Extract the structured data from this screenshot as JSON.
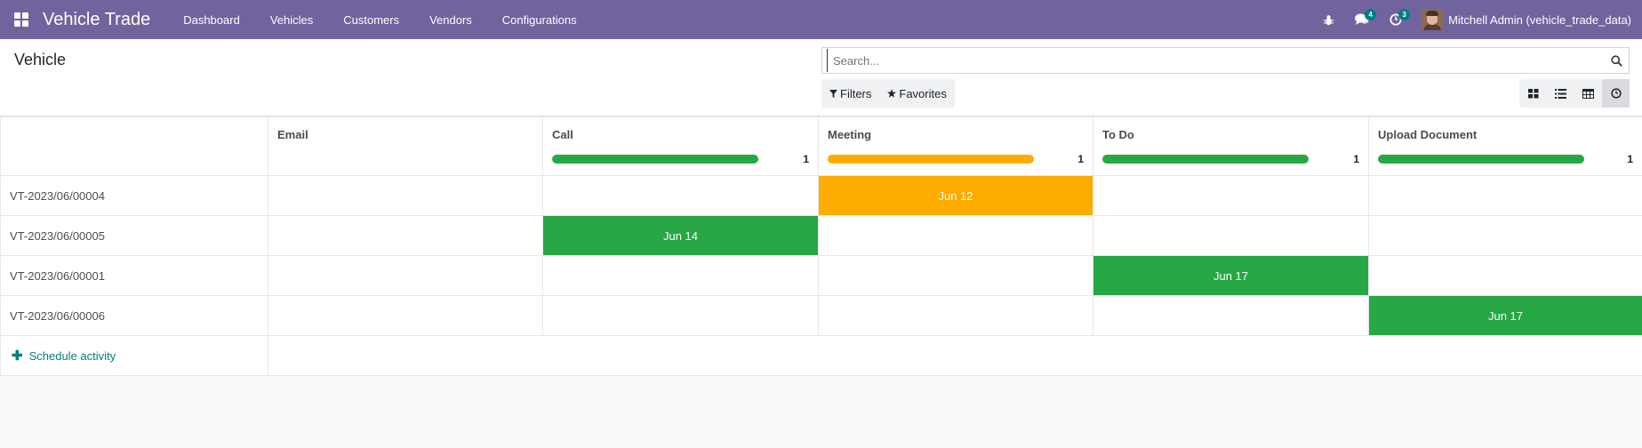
{
  "navbar": {
    "app_title": "Vehicle Trade",
    "menu": [
      "Dashboard",
      "Vehicles",
      "Customers",
      "Vendors",
      "Configurations"
    ],
    "messages_badge": "4",
    "activities_badge": "3",
    "user_name": "Mitchell Admin (vehicle_trade_data)",
    "bg_color": "#71639e"
  },
  "control_panel": {
    "breadcrumb": "Vehicle",
    "search_placeholder": "Search...",
    "filters_label": "Filters",
    "favorites_label": "Favorites",
    "views": [
      "kanban-icon",
      "list-icon",
      "pivot-icon",
      "activity-icon"
    ],
    "active_view": "activity-icon"
  },
  "activity_table": {
    "columns": [
      {
        "label": "Email",
        "count": "",
        "color": ""
      },
      {
        "label": "Call",
        "count": "1",
        "color": "#28a745"
      },
      {
        "label": "Meeting",
        "count": "1",
        "color": "#ffac00"
      },
      {
        "label": "To Do",
        "count": "1",
        "color": "#28a745"
      },
      {
        "label": "Upload Document",
        "count": "1",
        "color": "#28a745"
      }
    ],
    "rows": [
      {
        "record": "VT-2023/06/00004",
        "cells": [
          "",
          "",
          "Jun 12",
          "",
          ""
        ]
      },
      {
        "record": "VT-2023/06/00005",
        "cells": [
          "",
          "Jun 14",
          "",
          "",
          ""
        ]
      },
      {
        "record": "VT-2023/06/00001",
        "cells": [
          "",
          "",
          "",
          "Jun 17",
          ""
        ]
      },
      {
        "record": "VT-2023/06/00006",
        "cells": [
          "",
          "",
          "",
          "",
          "Jun 17"
        ]
      }
    ],
    "schedule_label": "Schedule activity"
  }
}
